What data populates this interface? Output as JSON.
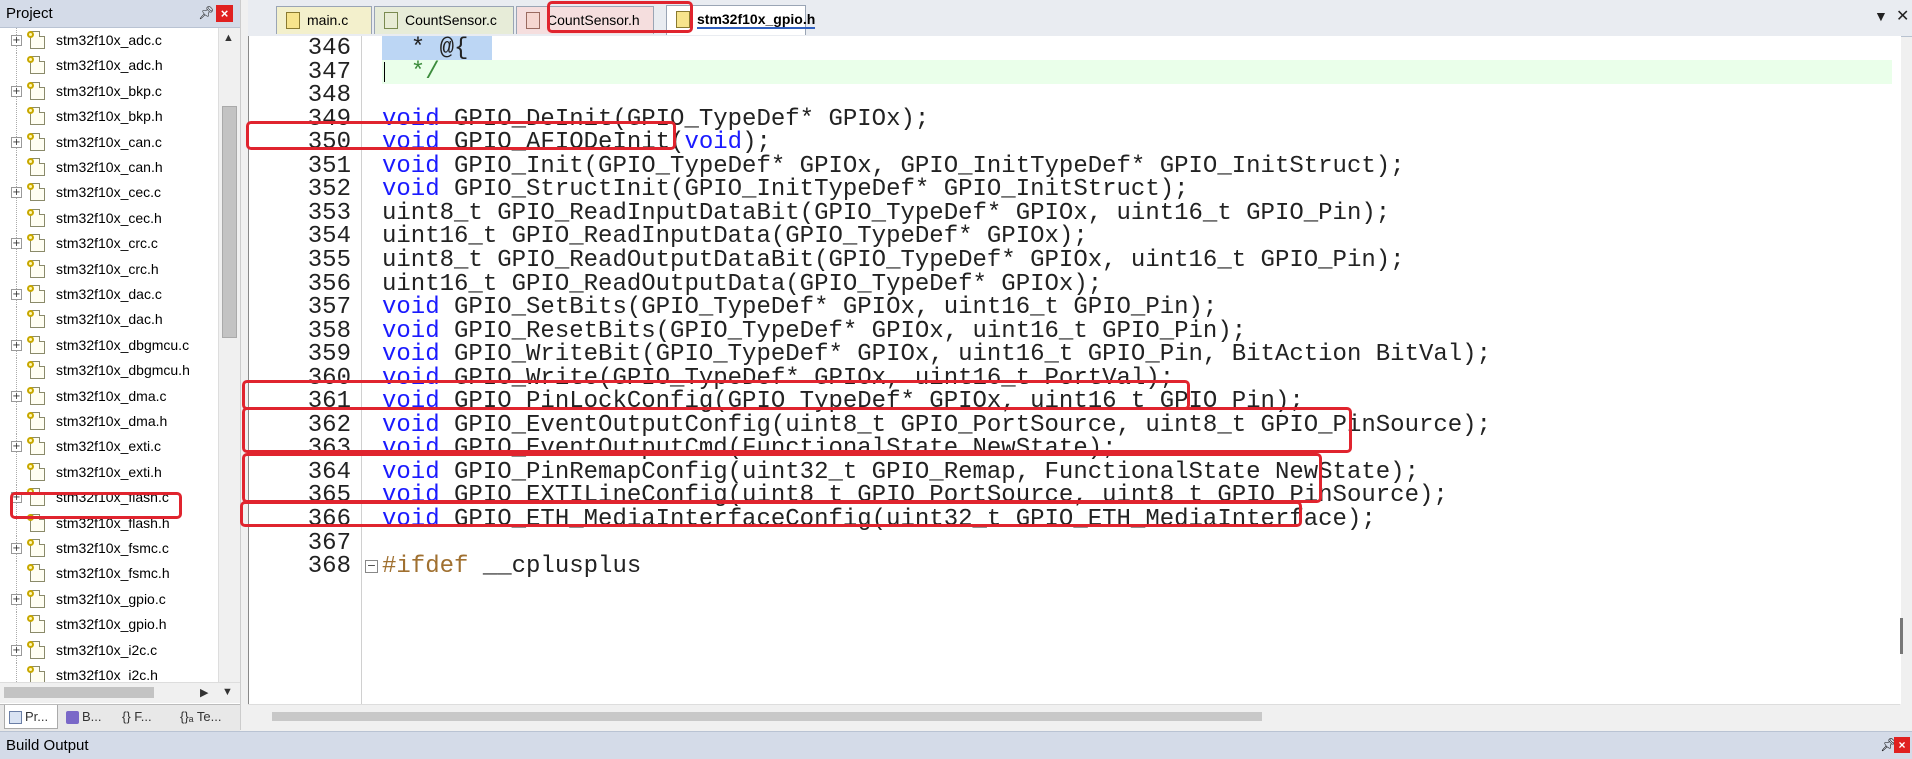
{
  "project_panel": {
    "title": "Project",
    "pin_icon": "pin-icon",
    "close_label": "×",
    "files": [
      {
        "name": "stm32f10x_adc.c",
        "expandable": true
      },
      {
        "name": "stm32f10x_adc.h",
        "expandable": false
      },
      {
        "name": "stm32f10x_bkp.c",
        "expandable": true
      },
      {
        "name": "stm32f10x_bkp.h",
        "expandable": false
      },
      {
        "name": "stm32f10x_can.c",
        "expandable": true
      },
      {
        "name": "stm32f10x_can.h",
        "expandable": false
      },
      {
        "name": "stm32f10x_cec.c",
        "expandable": true
      },
      {
        "name": "stm32f10x_cec.h",
        "expandable": false
      },
      {
        "name": "stm32f10x_crc.c",
        "expandable": true
      },
      {
        "name": "stm32f10x_crc.h",
        "expandable": false
      },
      {
        "name": "stm32f10x_dac.c",
        "expandable": true
      },
      {
        "name": "stm32f10x_dac.h",
        "expandable": false
      },
      {
        "name": "stm32f10x_dbgmcu.c",
        "expandable": true
      },
      {
        "name": "stm32f10x_dbgmcu.h",
        "expandable": false
      },
      {
        "name": "stm32f10x_dma.c",
        "expandable": true
      },
      {
        "name": "stm32f10x_dma.h",
        "expandable": false
      },
      {
        "name": "stm32f10x_exti.c",
        "expandable": true
      },
      {
        "name": "stm32f10x_exti.h",
        "expandable": false
      },
      {
        "name": "stm32f10x_flash.c",
        "expandable": true
      },
      {
        "name": "stm32f10x_flash.h",
        "expandable": false
      },
      {
        "name": "stm32f10x_fsmc.c",
        "expandable": true
      },
      {
        "name": "stm32f10x_fsmc.h",
        "expandable": false
      },
      {
        "name": "stm32f10x_gpio.c",
        "expandable": true
      },
      {
        "name": "stm32f10x_gpio.h",
        "expandable": false,
        "highlighted": true
      },
      {
        "name": "stm32f10x_i2c.c",
        "expandable": true
      },
      {
        "name": "stm32f10x_i2c.h",
        "expandable": false
      }
    ],
    "tabs": [
      {
        "label": "Pr...",
        "icon": "project-tab-icon"
      },
      {
        "label": "B...",
        "icon": "books-tab-icon"
      },
      {
        "label": "{} F...",
        "icon": "functions-tab-icon"
      },
      {
        "label": "{}ₐ Te...",
        "icon": "templates-tab-icon"
      }
    ]
  },
  "editor": {
    "tabs": [
      {
        "label": "main.c",
        "active": false
      },
      {
        "label": "CountSensor.c",
        "active": false
      },
      {
        "label": "CountSensor.h",
        "active": false
      },
      {
        "label": "stm32f10x_gpio.h",
        "active": true
      }
    ],
    "lines": [
      {
        "no": "346",
        "segments": [
          {
            "t": "  * @{",
            "c": ""
          }
        ]
      },
      {
        "no": "347",
        "segments": [
          {
            "t": "  */",
            "c": "cmt"
          }
        ]
      },
      {
        "no": "348",
        "segments": []
      },
      {
        "no": "349",
        "segments": [
          {
            "t": "void",
            "c": "kw"
          },
          {
            "t": " GPIO_DeInit(GPIO_TypeDef* GPIOx);",
            "c": ""
          }
        ]
      },
      {
        "no": "350",
        "segments": [
          {
            "t": "void",
            "c": "kw"
          },
          {
            "t": " GPIO_AFIODeInit(",
            "c": ""
          },
          {
            "t": "void",
            "c": "kw"
          },
          {
            "t": ");",
            "c": ""
          }
        ]
      },
      {
        "no": "351",
        "segments": [
          {
            "t": "void",
            "c": "kw"
          },
          {
            "t": " GPIO_Init(GPIO_TypeDef* GPIOx, GPIO_InitTypeDef* GPIO_InitStruct);",
            "c": ""
          }
        ]
      },
      {
        "no": "352",
        "segments": [
          {
            "t": "void",
            "c": "kw"
          },
          {
            "t": " GPIO_StructInit(GPIO_InitTypeDef* GPIO_InitStruct);",
            "c": ""
          }
        ]
      },
      {
        "no": "353",
        "segments": [
          {
            "t": "uint8_t GPIO_ReadInputDataBit(GPIO_TypeDef* GPIOx, uint16_t GPIO_Pin);",
            "c": ""
          }
        ]
      },
      {
        "no": "354",
        "segments": [
          {
            "t": "uint16_t GPIO_ReadInputData(GPIO_TypeDef* GPIOx);",
            "c": ""
          }
        ]
      },
      {
        "no": "355",
        "segments": [
          {
            "t": "uint8_t GPIO_ReadOutputDataBit(GPIO_TypeDef* GPIOx, uint16_t GPIO_Pin);",
            "c": ""
          }
        ]
      },
      {
        "no": "356",
        "segments": [
          {
            "t": "uint16_t GPIO_ReadOutputData(GPIO_TypeDef* GPIOx);",
            "c": ""
          }
        ]
      },
      {
        "no": "357",
        "segments": [
          {
            "t": "void",
            "c": "kw"
          },
          {
            "t": " GPIO_SetBits(GPIO_TypeDef* GPIOx, uint16_t GPIO_Pin);",
            "c": ""
          }
        ]
      },
      {
        "no": "358",
        "segments": [
          {
            "t": "void",
            "c": "kw"
          },
          {
            "t": " GPIO_ResetBits(GPIO_TypeDef* GPIOx, uint16_t GPIO_Pin);",
            "c": ""
          }
        ]
      },
      {
        "no": "359",
        "segments": [
          {
            "t": "void",
            "c": "kw"
          },
          {
            "t": " GPIO_WriteBit(GPIO_TypeDef* GPIOx, uint16_t GPIO_Pin, BitAction BitVal);",
            "c": ""
          }
        ]
      },
      {
        "no": "360",
        "segments": [
          {
            "t": "void",
            "c": "kw"
          },
          {
            "t": " GPIO_Write(GPIO_TypeDef* GPIOx, uint16_t PortVal);",
            "c": ""
          }
        ]
      },
      {
        "no": "361",
        "segments": [
          {
            "t": "void",
            "c": "kw"
          },
          {
            "t": " GPIO_PinLockConfig(GPIO_TypeDef* GPIOx, uint16_t GPIO_Pin);",
            "c": ""
          }
        ]
      },
      {
        "no": "362",
        "segments": [
          {
            "t": "void",
            "c": "kw"
          },
          {
            "t": " GPIO_EventOutputConfig(uint8_t GPIO_PortSource, uint8_t GPIO_PinSource);",
            "c": ""
          }
        ]
      },
      {
        "no": "363",
        "segments": [
          {
            "t": "void",
            "c": "kw"
          },
          {
            "t": " GPIO_EventOutputCmd(FunctionalState NewState);",
            "c": ""
          }
        ]
      },
      {
        "no": "364",
        "segments": [
          {
            "t": "void",
            "c": "kw"
          },
          {
            "t": " GPIO_PinRemapConfig(uint32_t GPIO_Remap, FunctionalState NewState);",
            "c": ""
          }
        ]
      },
      {
        "no": "365",
        "segments": [
          {
            "t": "void",
            "c": "kw"
          },
          {
            "t": " GPIO_EXTILineConfig(uint8_t GPIO_PortSource, uint8_t GPIO_PinSource);",
            "c": ""
          }
        ]
      },
      {
        "no": "366",
        "segments": [
          {
            "t": "void",
            "c": "kw"
          },
          {
            "t": " GPIO_ETH_MediaInterfaceConfig(uint32_t GPIO_ETH_MediaInterface);",
            "c": ""
          }
        ]
      },
      {
        "no": "367",
        "segments": []
      },
      {
        "no": "368",
        "segments": [
          {
            "t": "#ifdef",
            "c": "prep"
          },
          {
            "t": " __cplusplus",
            "c": ""
          }
        ]
      }
    ]
  },
  "build_output": {
    "title": "Build Output",
    "close_label": "×"
  },
  "colors": {
    "highlight_box": "#e0242e",
    "keyword": "#1a1aff",
    "comment": "#3c8c3c",
    "selection": "#bcd6f4"
  }
}
